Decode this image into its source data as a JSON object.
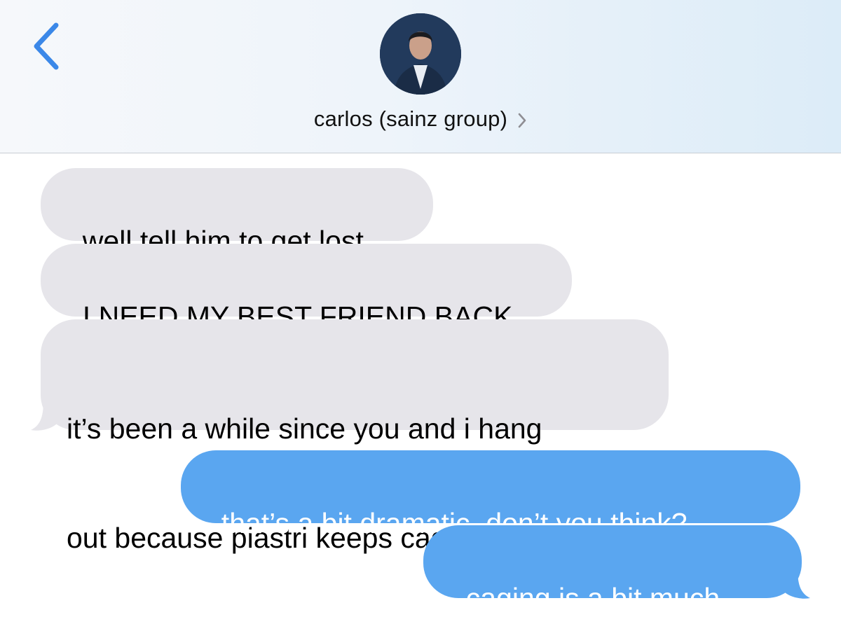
{
  "header": {
    "contact_name": "carlos (sainz group)",
    "back_icon": "chevron-left-icon",
    "disclosure_icon": "chevron-right-icon",
    "accent_color": "#3b88e8"
  },
  "messages": [
    {
      "direction": "received",
      "text": "well tell him to get lost"
    },
    {
      "direction": "received",
      "text": "I NEED MY BEST FRIEND BACK"
    },
    {
      "direction": "received",
      "lines": [
        "it’s been a while since you and i hang",
        "out because piastri keeps caging you"
      ]
    },
    {
      "direction": "sent",
      "text": "that’s a bit dramatic, don’t you think?"
    },
    {
      "direction": "sent",
      "text": "caging is a bit much.."
    }
  ],
  "colors": {
    "received_bubble": "#e6e5ea",
    "sent_bubble": "#5aa6f0",
    "sent_text": "#ffffff"
  }
}
